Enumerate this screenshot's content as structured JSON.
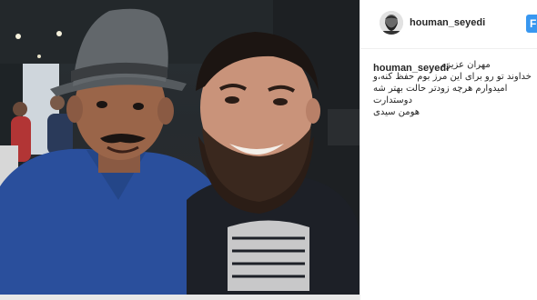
{
  "post": {
    "image_alt": "Photo of two men smiling, selfie",
    "username": "houman_seyedi",
    "follow_label": "F",
    "caption": {
      "user": "houman_seyedi",
      "lines": [
        "مهران عزیزم",
        "خداوند تو رو برای این مرز بوم حفظ کنه،و",
        "امیدوارم هرچه زودتر حالت بهتر شه",
        "دوستدارت",
        "هومن سیدی"
      ]
    }
  },
  "colors": {
    "accent": "#3897f0",
    "text": "#262626",
    "divider": "#efefef"
  }
}
